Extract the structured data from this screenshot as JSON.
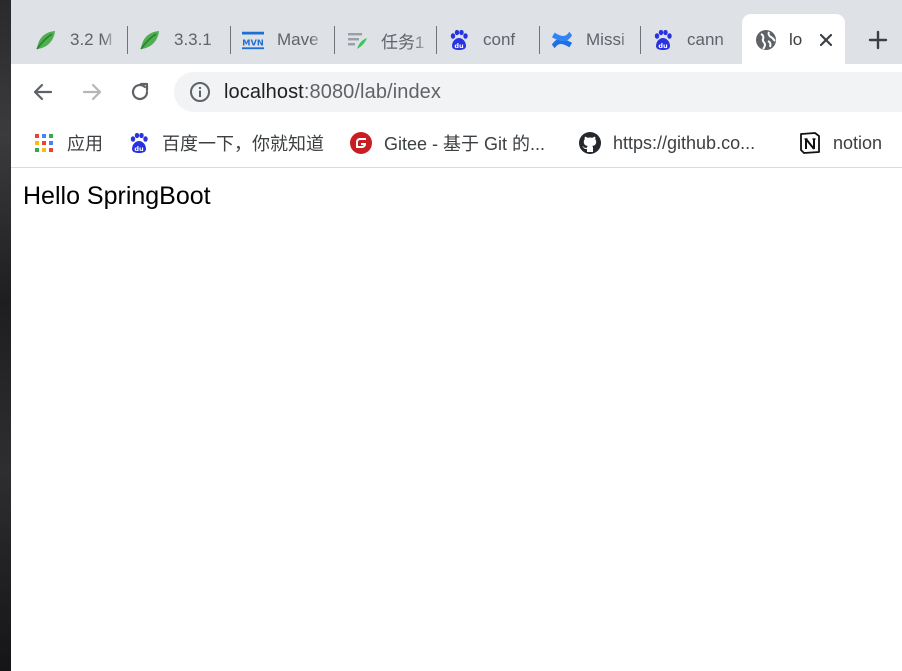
{
  "browser": {
    "tabs": [
      {
        "title": "3.2 M",
        "icon": "leaf-icon"
      },
      {
        "title": "3.3.1",
        "icon": "leaf-icon"
      },
      {
        "title": "Mave",
        "icon": "maven-icon"
      },
      {
        "title": "任务1",
        "icon": "task-icon"
      },
      {
        "title": "conf",
        "icon": "baidu-icon"
      },
      {
        "title": "Missi",
        "icon": "confluence-icon"
      },
      {
        "title": "cann",
        "icon": "baidu-icon"
      },
      {
        "title": "lo",
        "icon": "globe-icon",
        "active": true
      }
    ],
    "address": {
      "host": "localhost",
      "rest": ":8080/lab/index"
    },
    "bookmarks": [
      {
        "label": "应用",
        "icon": "apps-grid-icon"
      },
      {
        "label": "百度一下，你就知道",
        "icon": "baidu-icon"
      },
      {
        "label": "Gitee - 基于 Git 的...",
        "icon": "gitee-icon"
      },
      {
        "label": "https://github.co...",
        "icon": "github-icon"
      },
      {
        "label": "notion",
        "icon": "notion-icon"
      }
    ],
    "colors": {
      "tabstrip_bg": "#dee1e6",
      "omnibox_bg": "#f1f3f4",
      "baidu_blue": "#2932e1",
      "gitee_red": "#c71d23"
    }
  },
  "page": {
    "body_text": "Hello SpringBoot"
  }
}
